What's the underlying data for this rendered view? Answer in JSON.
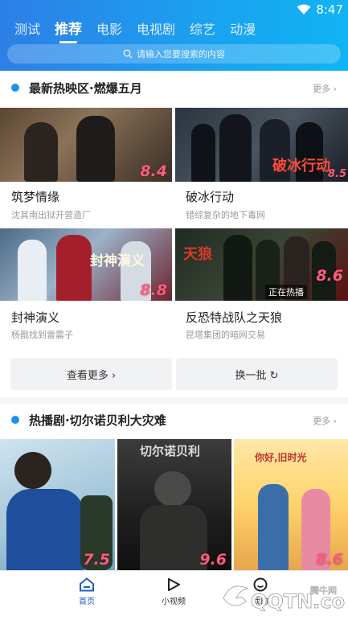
{
  "status": {
    "time": "8:47"
  },
  "tabs": [
    {
      "label": "测试"
    },
    {
      "label": "推荐"
    },
    {
      "label": "电影"
    },
    {
      "label": "电视剧"
    },
    {
      "label": "综艺"
    },
    {
      "label": "动漫"
    }
  ],
  "search": {
    "placeholder": "请输入您要搜索的内容"
  },
  "section1": {
    "title": "最新热映区·燃爆五月",
    "more": "更多 ›",
    "items": [
      {
        "title": "筑梦情缘",
        "subtitle": "沈其南出狱开营造厂",
        "score": "8.4"
      },
      {
        "title": "破冰行动",
        "subtitle": "错综复杂的地下毒网",
        "score": "8.5",
        "overlay": "破冰行动"
      },
      {
        "title": "封神演义",
        "subtitle": "杨戬找到雷震子",
        "score": "8.8",
        "overlay": "封神演义"
      },
      {
        "title": "反恐特战队之天狼",
        "subtitle": "昆塔集团的暗网交易",
        "score": "8.6",
        "overlay": "天狼",
        "tag": "正在热播"
      }
    ],
    "btn_more": "查看更多 ›",
    "btn_refresh": "换一批 ↻"
  },
  "section2": {
    "title": "热播剧·切尔诺贝利大灾难",
    "more": "更多 ›",
    "items": [
      {
        "score": "7.5"
      },
      {
        "score": "9.6",
        "overlay": "切尔诺贝利"
      },
      {
        "score": "8.6",
        "overlay": "你好,旧时光"
      }
    ]
  },
  "nav": [
    {
      "label": "首页"
    },
    {
      "label": "小视频"
    },
    {
      "label": "我的"
    }
  ],
  "watermark": {
    "text1": "QQTN.com",
    "text2": "腾牛网"
  },
  "colors": {
    "accent": "#1e8fec",
    "score": "#ff5b7d",
    "header_start": "#2d7fe6",
    "header_end": "#10b4f3"
  }
}
